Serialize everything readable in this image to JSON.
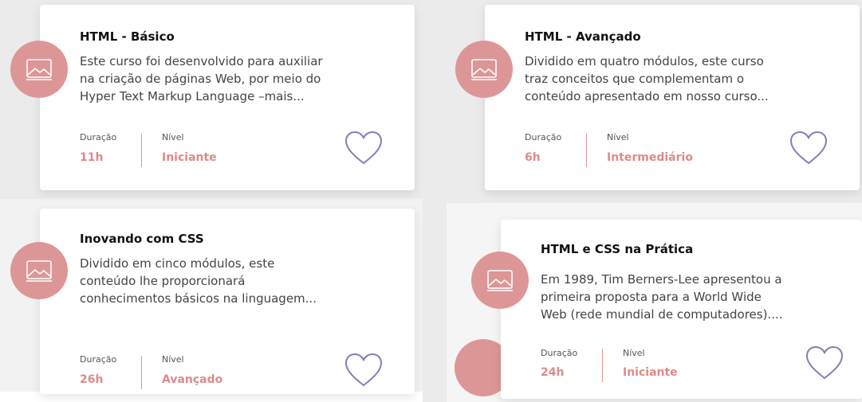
{
  "labels": {
    "duration": "Duração",
    "level": "Nível"
  },
  "colors": {
    "accent": "#dd9696",
    "heart": "#8a7ab8",
    "title": "#111111"
  },
  "courses": [
    {
      "title": "HTML - Básico",
      "desc": [
        "Este curso foi desenvolvido para auxiliar",
        "na criação de páginas Web, por meio do",
        "Hyper Text Markup Language –mais..."
      ],
      "duration": "11h",
      "level": "Iniciante",
      "icon": "image-placeholder-icon"
    },
    {
      "title": "HTML - Avançado",
      "desc": [
        "Dividido em quatro módulos, este curso",
        "traz conceitos que complementam o",
        "conteúdo apresentado em nosso curso..."
      ],
      "duration": "6h",
      "level": "Intermediário",
      "icon": "image-placeholder-icon"
    },
    {
      "title": "Inovando com CSS",
      "desc": [
        "Dividido em cinco módulos, este",
        "conteúdo lhe proporcionará",
        "conhecimentos básicos na linguagem..."
      ],
      "duration": "26h",
      "level": "Avançado",
      "icon": "image-placeholder-icon"
    },
    {
      "title": "HTML e CSS na Prática",
      "desc": [
        "Em 1989, Tim Berners-Lee apresentou a",
        "primeira proposta para a World Wide",
        "Web (rede mundial de computadores)...."
      ],
      "duration": "24h",
      "level": "Iniciante",
      "icon": "image-placeholder-icon"
    }
  ]
}
